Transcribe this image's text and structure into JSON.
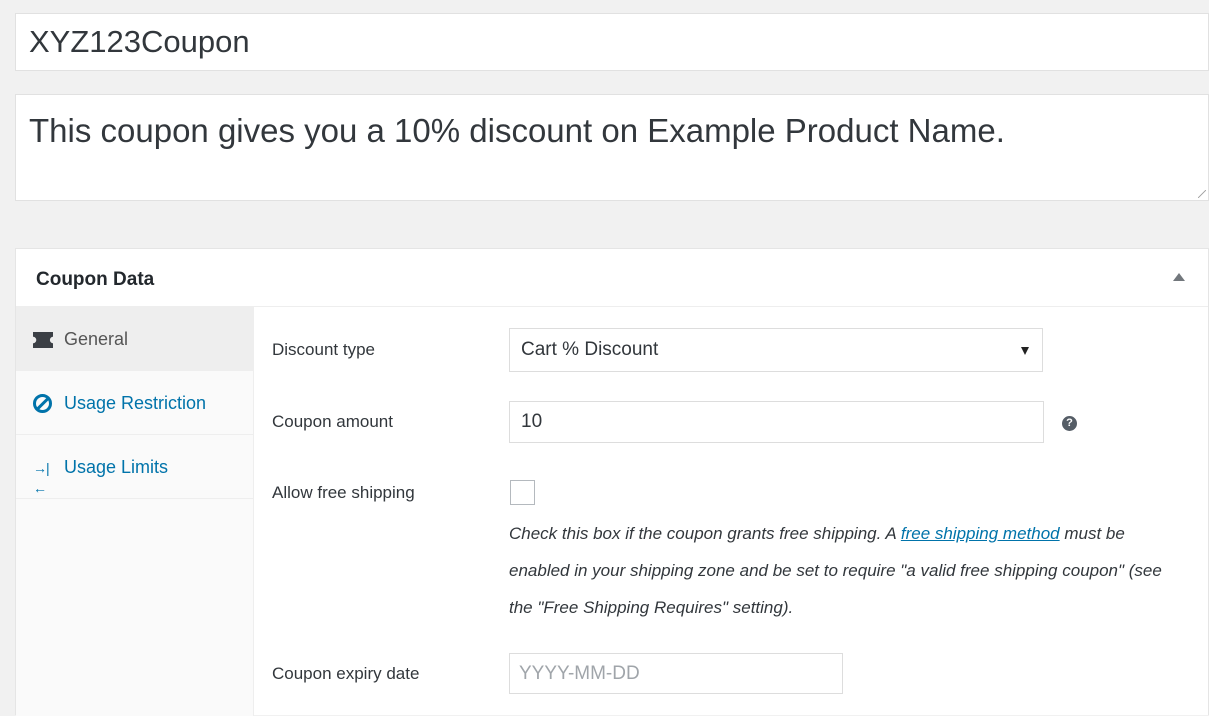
{
  "coupon": {
    "code": "XYZ123Coupon",
    "description": "This coupon gives you a 10% discount on Example Product Name."
  },
  "panel": {
    "title": "Coupon Data",
    "toggle_icon": "collapse-arrow-icon"
  },
  "tabs": [
    {
      "label": "General",
      "icon": "ticket-icon",
      "active": true
    },
    {
      "label": "Usage Restriction",
      "icon": "forbidden-icon",
      "active": false
    },
    {
      "label": "Usage Limits",
      "icon": "limits-icon",
      "active": false
    }
  ],
  "fields": {
    "discount_type": {
      "label": "Discount type",
      "value": "Cart % Discount"
    },
    "coupon_amount": {
      "label": "Coupon amount",
      "value": "10",
      "help_icon": "question-icon"
    },
    "free_shipping": {
      "label": "Allow free shipping",
      "checked": false,
      "desc_before": "Check this box if the coupon grants free shipping. A ",
      "desc_link": "free shipping method",
      "desc_after": " must be enabled in your shipping zone and be set to require \"a valid free shipping coupon\" (see the \"Free Shipping Requires\" setting)."
    },
    "expiry_date": {
      "label": "Coupon expiry date",
      "placeholder": "YYYY-MM-DD"
    }
  },
  "colors": {
    "link": "#0073aa",
    "background": "#f1f1f1"
  }
}
